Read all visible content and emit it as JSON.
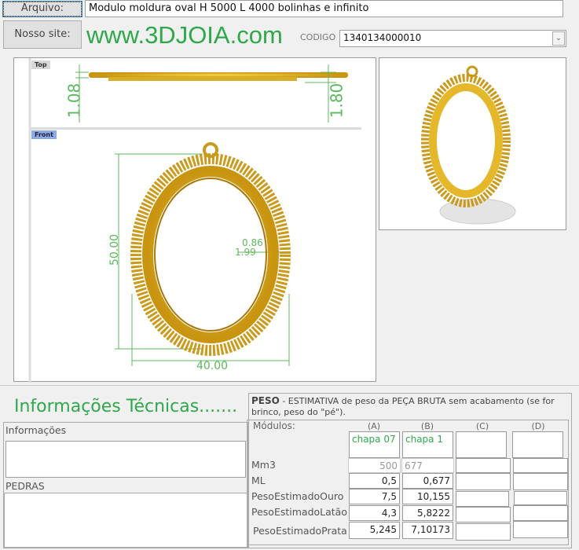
{
  "header": {
    "arquivo_label": "Arquivo:",
    "arquivo_value": "Modulo moldura oval H 5000 L 4000 bolinhas e infinito",
    "site_button": "Nosso site:",
    "site_url": "www.3DJOIA.com",
    "codigo_label": "CODIGO",
    "codigo_value": "1340134000010"
  },
  "drawing": {
    "top_tab": "Top",
    "front_tab": "Front",
    "dims": {
      "top_left": "1.08",
      "top_right": "1.80",
      "height": "50.00",
      "width": "40.00",
      "small_a": "0.86",
      "small_b": "1.99"
    }
  },
  "info": {
    "title": "Informações Técnicas.......",
    "informacoes_label": "Informações",
    "informacoes_value": "",
    "pedras_label": "PEDRAS",
    "pedras_value": ""
  },
  "peso": {
    "title": "PESO",
    "description": " -  ESTIMATIVA de peso da PEÇA BRUTA sem acabamento (se for brinco, peso do \"pé\").",
    "modulos_label": "Módulos:",
    "columns": [
      "(A)",
      "(B)",
      "(C)",
      "(D)"
    ],
    "names": [
      "chapa 07",
      "chapa 1",
      "",
      ""
    ],
    "rows": [
      {
        "label": "Mm3",
        "values": [
          "500",
          "677",
          "",
          ""
        ]
      },
      {
        "label": "ML",
        "values": [
          "0,5",
          "0,677",
          "",
          ""
        ]
      },
      {
        "label": "PesoEstimadoOuro",
        "values": [
          "7,5",
          "10,155",
          "",
          ""
        ]
      },
      {
        "label": "PesoEstimadoLatão",
        "values": [
          "4,3",
          "5,8222",
          "",
          ""
        ]
      },
      {
        "label": "PesoEstimadoPrata",
        "values": [
          "5,245",
          "7,10173",
          "",
          ""
        ]
      }
    ]
  },
  "colors": {
    "brand_green": "#2ea84a",
    "gold": "#d4a017",
    "dim_green": "#5cb85c"
  }
}
